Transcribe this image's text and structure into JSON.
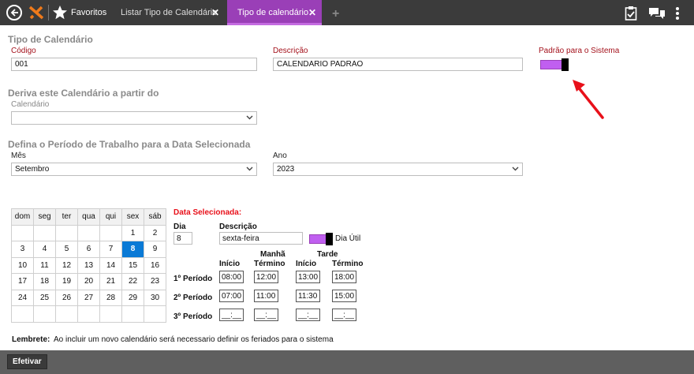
{
  "topbar": {
    "favorites_label": "Favoritos",
    "tabs": [
      {
        "label": "Listar Tipo de Calendário"
      },
      {
        "label": "Tipo de calendário"
      }
    ],
    "add_tab_symbol": "+"
  },
  "form": {
    "section_title": "Tipo de Calendário",
    "codigo_label": "Código",
    "codigo_value": "001",
    "descricao_label": "Descrição",
    "descricao_value": "CALENDARIO PADRÃO",
    "padrao_label": "Padrão para o Sistema",
    "padrao_enabled": true
  },
  "derive": {
    "section_title": "Deriva este Calendário a partir do",
    "calendario_label": "Calendário",
    "calendario_value": ""
  },
  "period": {
    "section_title": "Defina o Período de Trabalho para a Data Selecionada",
    "mes_label": "Mês",
    "mes_value": "Setembro",
    "ano_label": "Ano",
    "ano_value": "2023"
  },
  "calendar": {
    "weekdays": [
      "dom",
      "seg",
      "ter",
      "qua",
      "qui",
      "sex",
      "sáb"
    ],
    "weeks": [
      [
        "",
        "",
        "",
        "",
        "",
        "1",
        "2"
      ],
      [
        "3",
        "4",
        "5",
        "6",
        "7",
        "8",
        "9"
      ],
      [
        "10",
        "11",
        "12",
        "13",
        "14",
        "15",
        "16"
      ],
      [
        "17",
        "18",
        "19",
        "20",
        "21",
        "22",
        "23"
      ],
      [
        "24",
        "25",
        "26",
        "27",
        "28",
        "29",
        "30"
      ],
      [
        "",
        "",
        "",
        "",
        "",
        "",
        ""
      ]
    ],
    "selected_day": "8"
  },
  "selected": {
    "title": "Data Selecionada:",
    "dia_label": "Dia",
    "dia_value": "8",
    "descricao_label": "Descrição",
    "descricao_value": "sexta-feira",
    "dia_util_label": "Dia Útil",
    "dia_util_enabled": true,
    "manha_label": "Manhã",
    "tarde_label": "Tarde",
    "inicio_label": "Início",
    "termino_label": "Término",
    "periods": [
      {
        "label": "1º Período",
        "m_ini": "08:00",
        "m_fim": "12:00",
        "t_ini": "13:00",
        "t_fim": "18:00"
      },
      {
        "label": "2º Período",
        "m_ini": "07:00",
        "m_fim": "11:00",
        "t_ini": "11:30",
        "t_fim": "15:00"
      },
      {
        "label": "3º Período",
        "m_ini": "__:__",
        "m_fim": "__:__",
        "t_ini": "__:__",
        "t_fim": "__:__"
      }
    ]
  },
  "reminder": {
    "label": "Lembrete:",
    "text": "Ao incluir um novo calendário será necessario definir os feriados para o sistema"
  },
  "footer": {
    "efetivar_label": "Efetivar"
  },
  "colors": {
    "accent": "#9a3fb7",
    "toggle": "#c05ff0",
    "selected_day": "#0a7ad6",
    "label_red": "#a4121c",
    "annotation_arrow": "#e8101a"
  }
}
